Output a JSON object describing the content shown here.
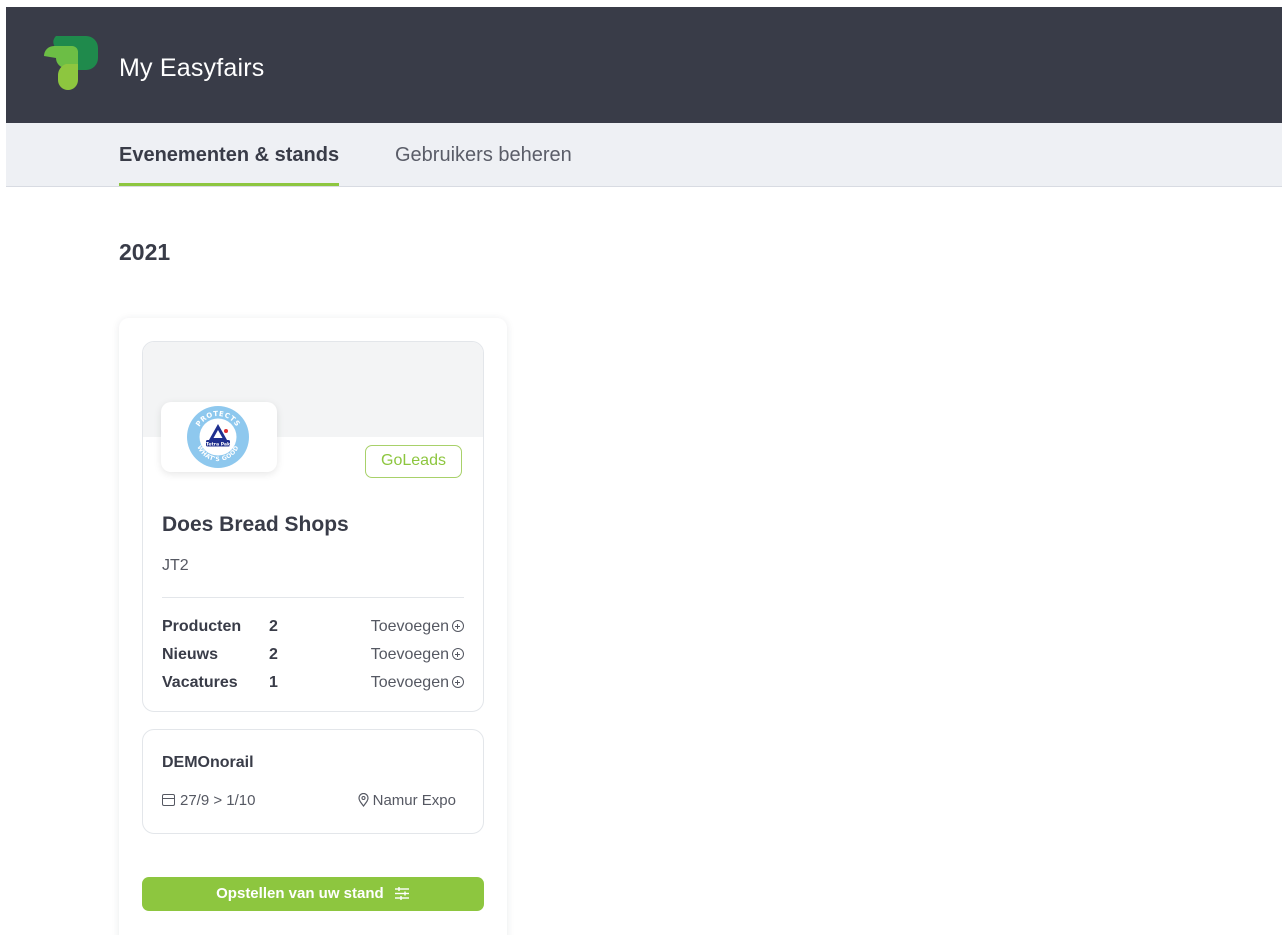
{
  "header": {
    "app_title": "My Easyfairs",
    "logo_icon": "easyfairs-logo-icon",
    "background_color": "#393c48"
  },
  "tabs": [
    {
      "label": "Evenementen & stands",
      "active": true
    },
    {
      "label": "Gebruikers beheren",
      "active": false
    }
  ],
  "colors": {
    "accent": "#8dc63f",
    "tab_bar": "#eef0f4"
  },
  "year": "2021",
  "stand": {
    "company_logo_icon": "tetra-pak-logo-icon",
    "logo_text": {
      "top": "PROTECTS",
      "bottom": "WHAT'S GOOD",
      "brand": "Tetra Pak"
    },
    "badge": "GoLeads",
    "company_name": "Does Bread Shops",
    "stand_number": "JT2",
    "stats": [
      {
        "label": "Producten",
        "count": "2",
        "action": "Toevoegen"
      },
      {
        "label": "Nieuws",
        "count": "2",
        "action": "Toevoegen"
      },
      {
        "label": "Vacatures",
        "count": "1",
        "action": "Toevoegen"
      }
    ]
  },
  "event": {
    "name": "DEMOnorail",
    "dates": "27/9 > 1/10",
    "location": "Namur Expo"
  },
  "primary_button": {
    "label": "Opstellen van uw stand",
    "icon": "sliders-icon"
  }
}
